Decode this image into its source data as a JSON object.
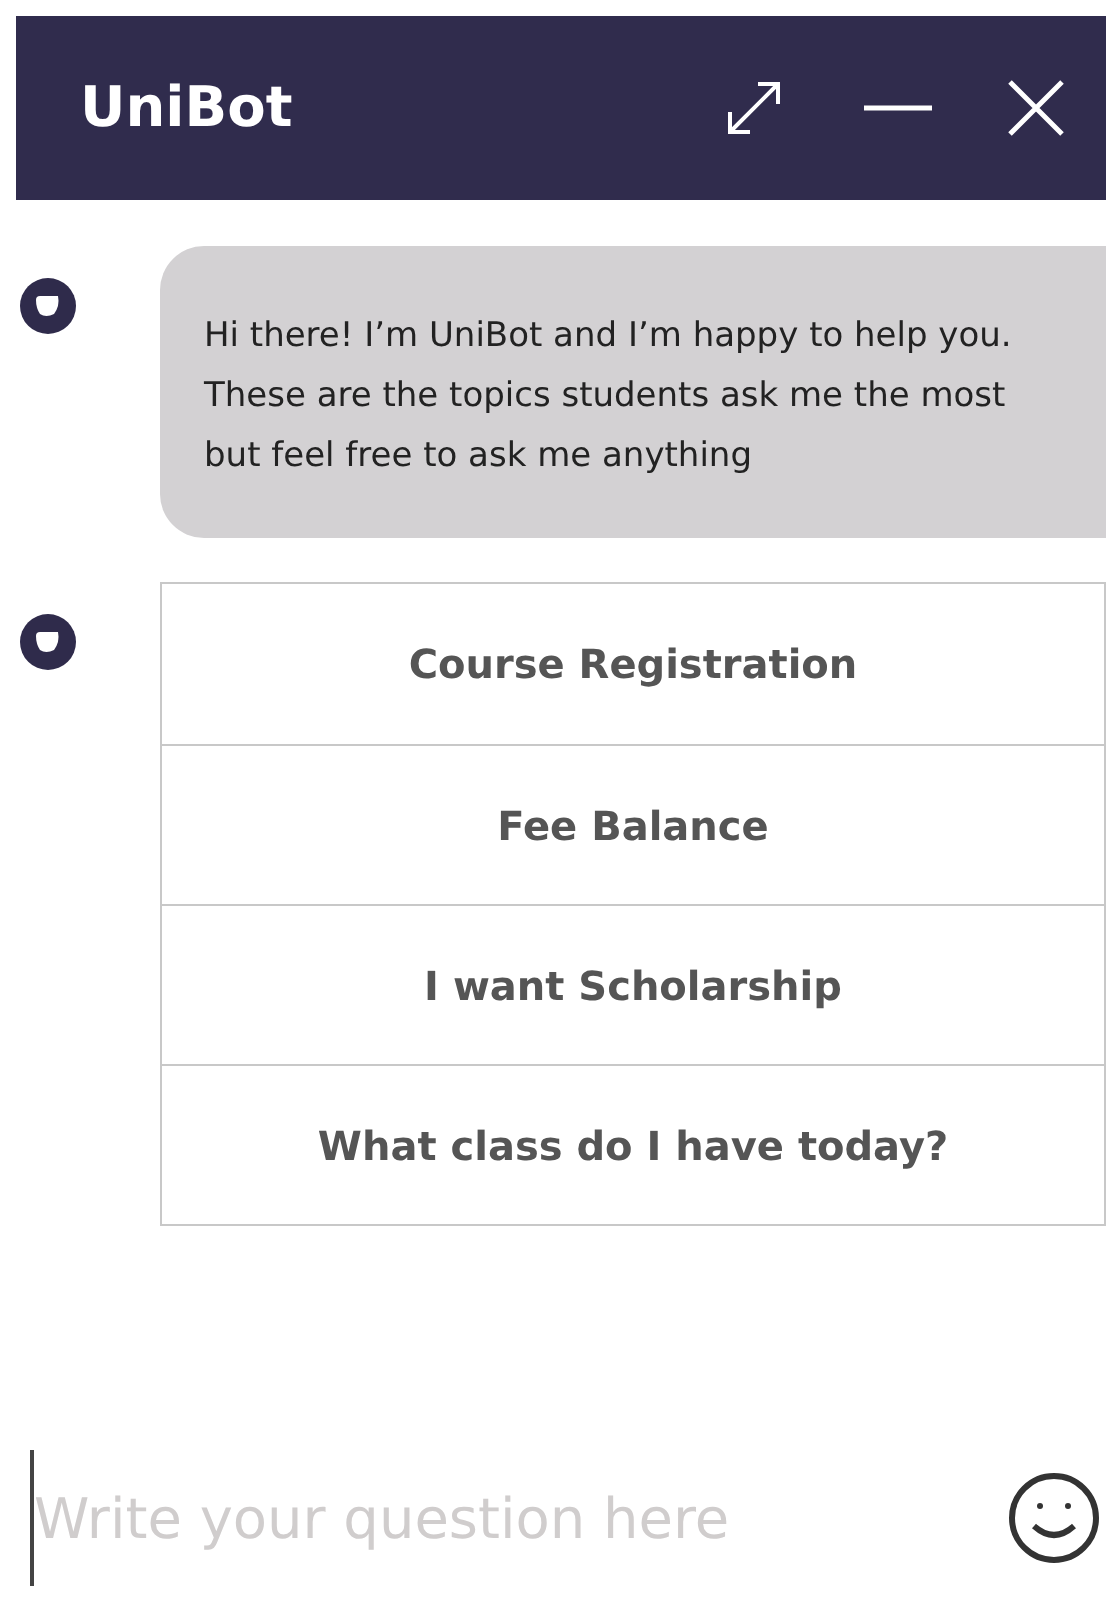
{
  "window": {
    "title": "UniBot"
  },
  "messages": [
    {
      "kind": "text",
      "text": "Hi there! I’m UniBot and I’m happy to help you. These are the topics students ask me the most but feel free to ask me anything"
    },
    {
      "kind": "options",
      "options": [
        "Course Registration",
        "Fee Balance",
        "I want Scholarship",
        "What class do I have today?"
      ]
    }
  ],
  "composer": {
    "placeholder": "Write your question here"
  }
}
